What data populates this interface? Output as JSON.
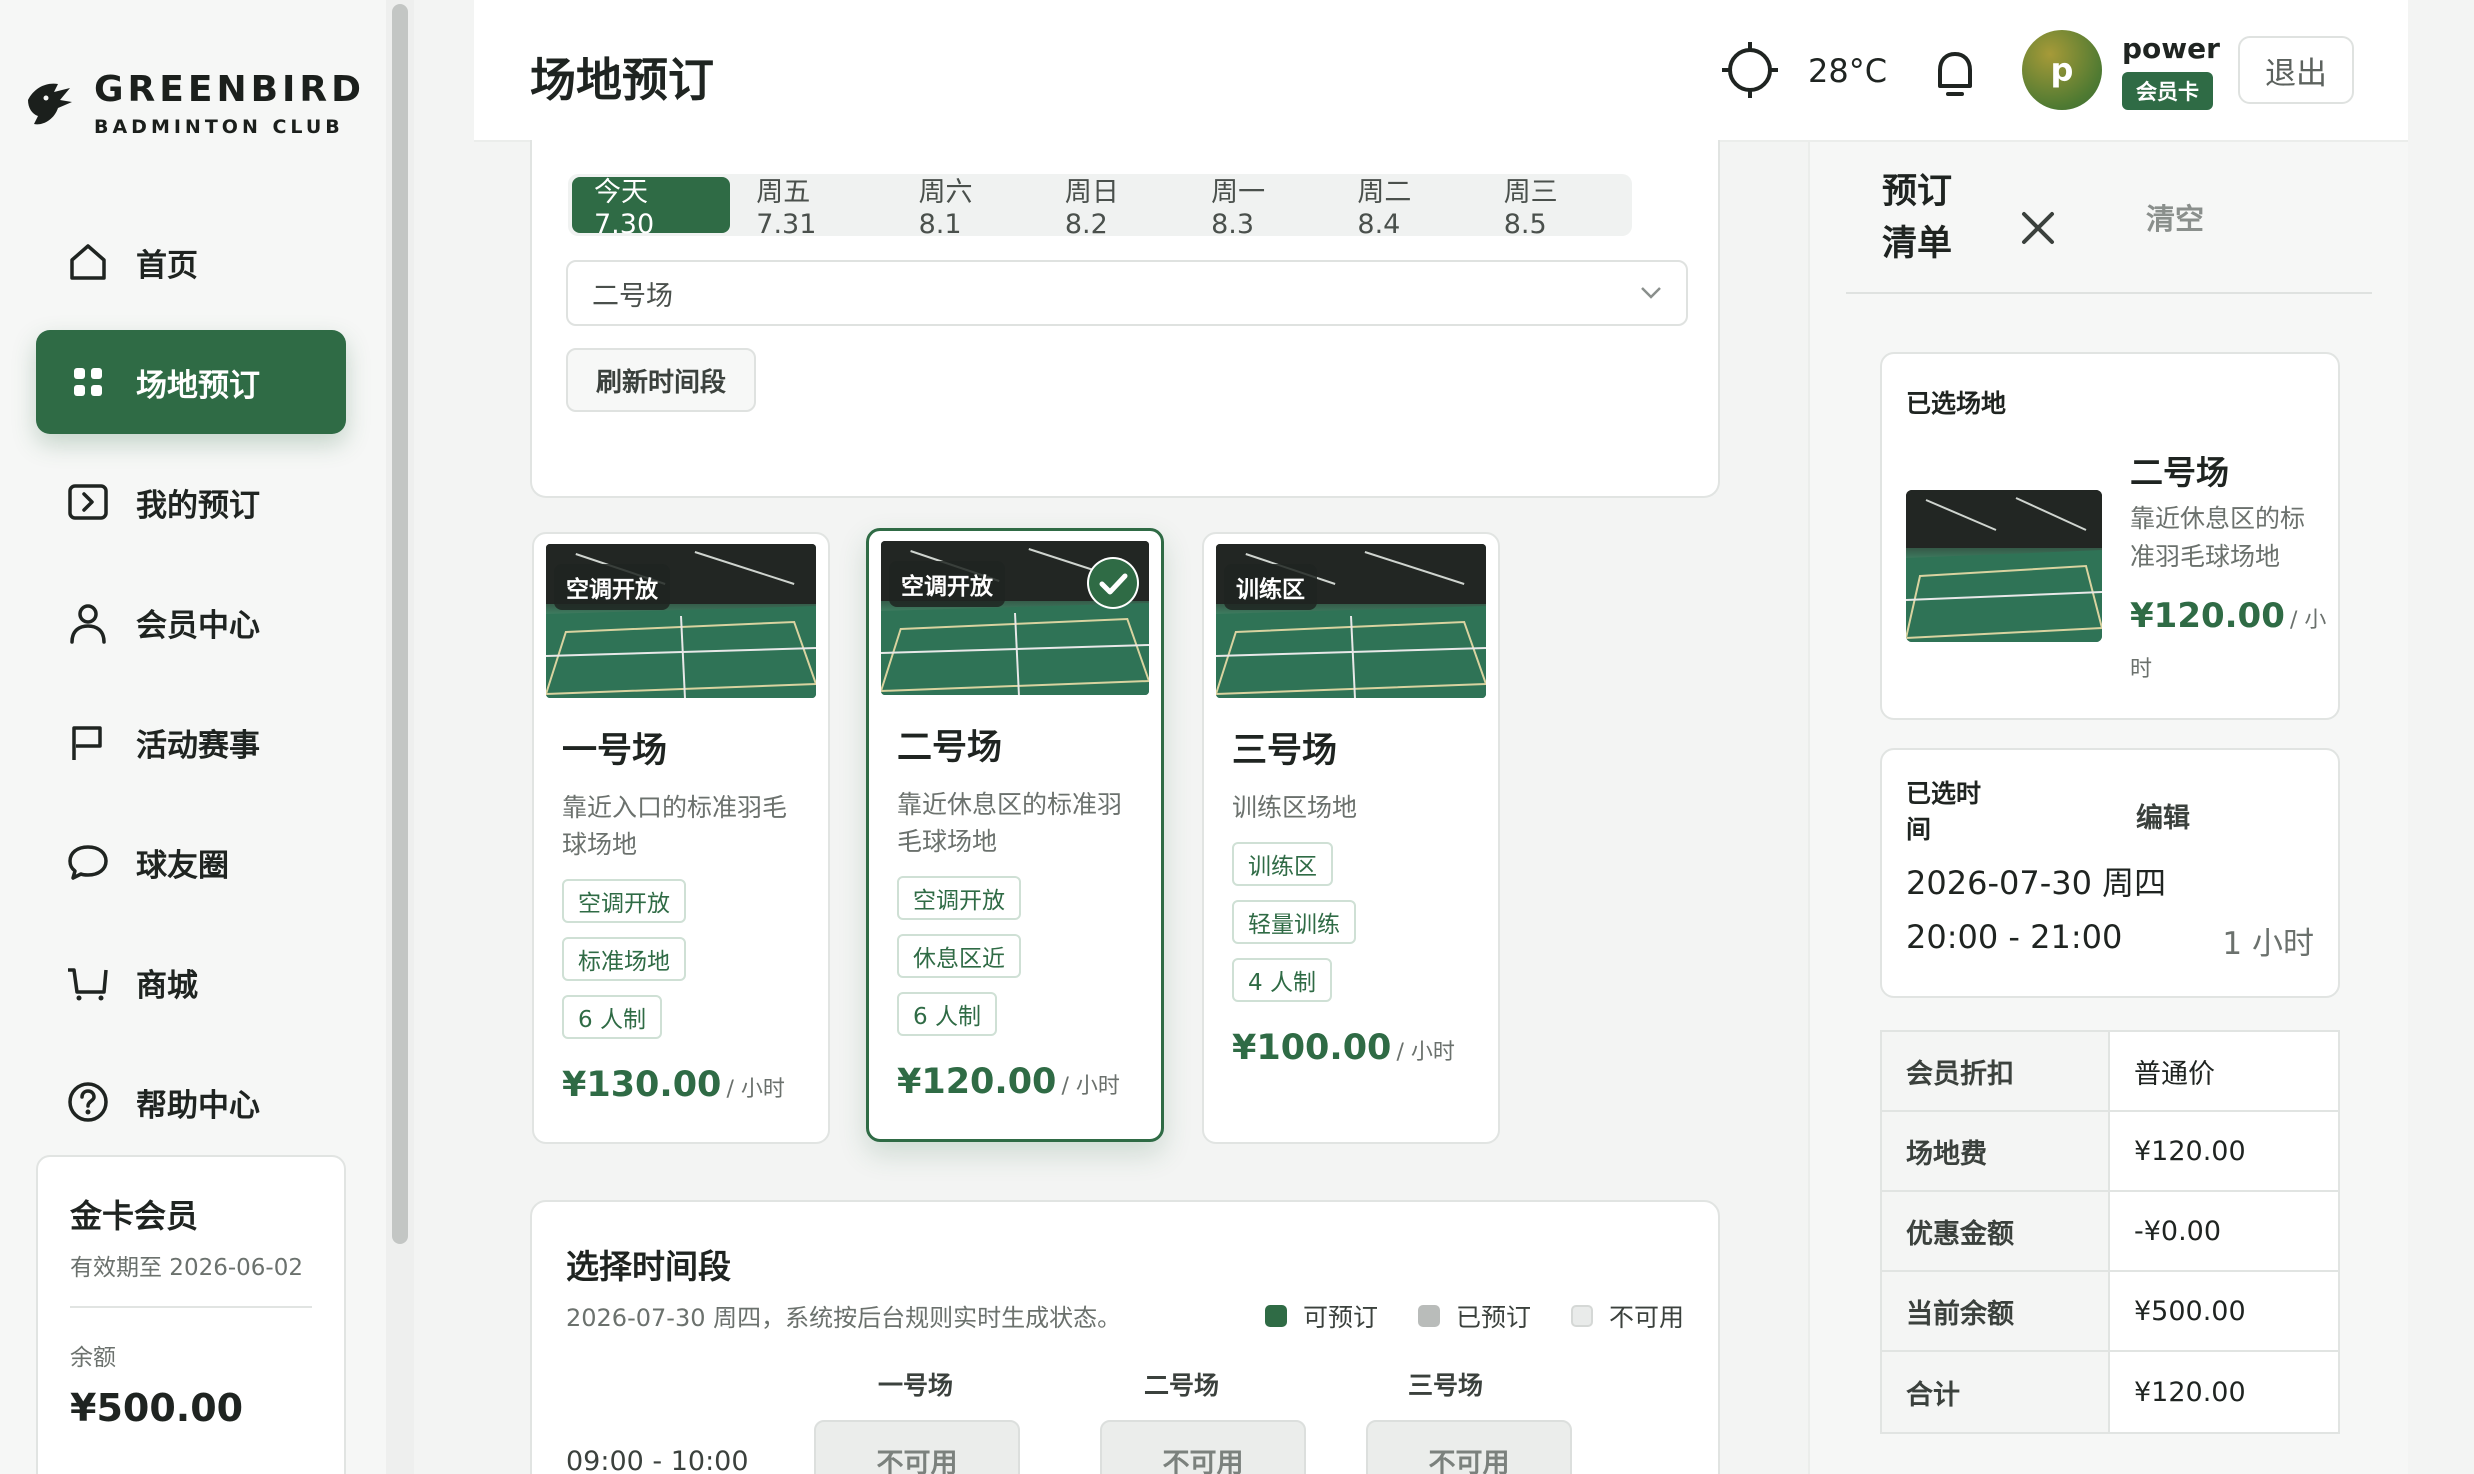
{
  "brand": {
    "name": "GREENBIRD",
    "sub": "BADMINTON CLUB"
  },
  "nav": [
    {
      "label": "首页",
      "icon": "home-icon"
    },
    {
      "label": "场地预订",
      "icon": "grid-icon",
      "active": true
    },
    {
      "label": "我的预订",
      "icon": "arrow-box-icon"
    },
    {
      "label": "会员中心",
      "icon": "user-icon"
    },
    {
      "label": "活动赛事",
      "icon": "flag-icon"
    },
    {
      "label": "球友圈",
      "icon": "chat-bubble-icon"
    },
    {
      "label": "商城",
      "icon": "cart-icon"
    },
    {
      "label": "帮助中心",
      "icon": "help-icon"
    }
  ],
  "member": {
    "tier": "金卡会员",
    "expire": "有效期至 2026-06-02",
    "balance_label": "余额",
    "balance": "¥500.00"
  },
  "header": {
    "title": "场地预订",
    "temperature": "28°C",
    "avatar_letter": "p",
    "username": "power",
    "badge": "会员卡",
    "logout": "退出"
  },
  "dates": [
    "今天 7.30",
    "周五 7.31",
    "周六 8.1",
    "周日 8.2",
    "周一 8.3",
    "周二 8.4",
    "周三 8.5"
  ],
  "court_select": {
    "value": "二号场"
  },
  "refresh_label": "刷新时间段",
  "courts": [
    {
      "tag": "空调开放",
      "name": "一号场",
      "desc": "靠近入口的标准羽毛球场地",
      "features": [
        "空调开放",
        "标准场地",
        "6 人制"
      ],
      "price": "¥130.00",
      "unit": "/ 小时",
      "selected": false
    },
    {
      "tag": "空调开放",
      "name": "二号场",
      "desc": "靠近休息区的标准羽毛球场地",
      "features": [
        "空调开放",
        "休息区近",
        "6 人制"
      ],
      "price": "¥120.00",
      "unit": "/ 小时",
      "selected": true
    },
    {
      "tag": "训练区",
      "name": "三号场",
      "desc": "训练区场地",
      "features": [
        "训练区",
        "轻量训练",
        "4 人制"
      ],
      "price": "¥100.00",
      "unit": "/ 小时",
      "selected": false
    }
  ],
  "time_section": {
    "title": "选择时间段",
    "subtitle": "2026-07-30 周四，系统按后台规则实时生成状态。",
    "legend": [
      {
        "label": "可预订",
        "color": "#2f6b45"
      },
      {
        "label": "已预订",
        "color": "#b9bcba"
      },
      {
        "label": "不可用",
        "color": "#e9ebea"
      }
    ],
    "columns": [
      "一号场",
      "二号场",
      "三号场"
    ],
    "rows": [
      {
        "time": "09:00 - 10:00",
        "slots": [
          "不可用",
          "不可用",
          "不可用"
        ]
      }
    ]
  },
  "cart": {
    "title": "预订清单",
    "clear": "清空",
    "selected_label": "已选场地",
    "court_name": "二号场",
    "court_desc": "靠近休息区的标准羽毛球场地",
    "court_price": "¥120.00",
    "court_unit": "/ 小时",
    "time_label": "已选时间",
    "edit": "编辑",
    "date": "2026-07-30 周四",
    "range": "20:00 - 21:00",
    "duration": "1 小时",
    "summary": [
      {
        "key": "会员折扣",
        "value": "普通价"
      },
      {
        "key": "场地费",
        "value": "¥120.00"
      },
      {
        "key": "优惠金额",
        "value": "-¥0.00"
      },
      {
        "key": "当前余额",
        "value": "¥500.00"
      },
      {
        "key": "合计",
        "value": "¥120.00"
      }
    ]
  },
  "colors": {
    "accent": "#2f6b45"
  }
}
